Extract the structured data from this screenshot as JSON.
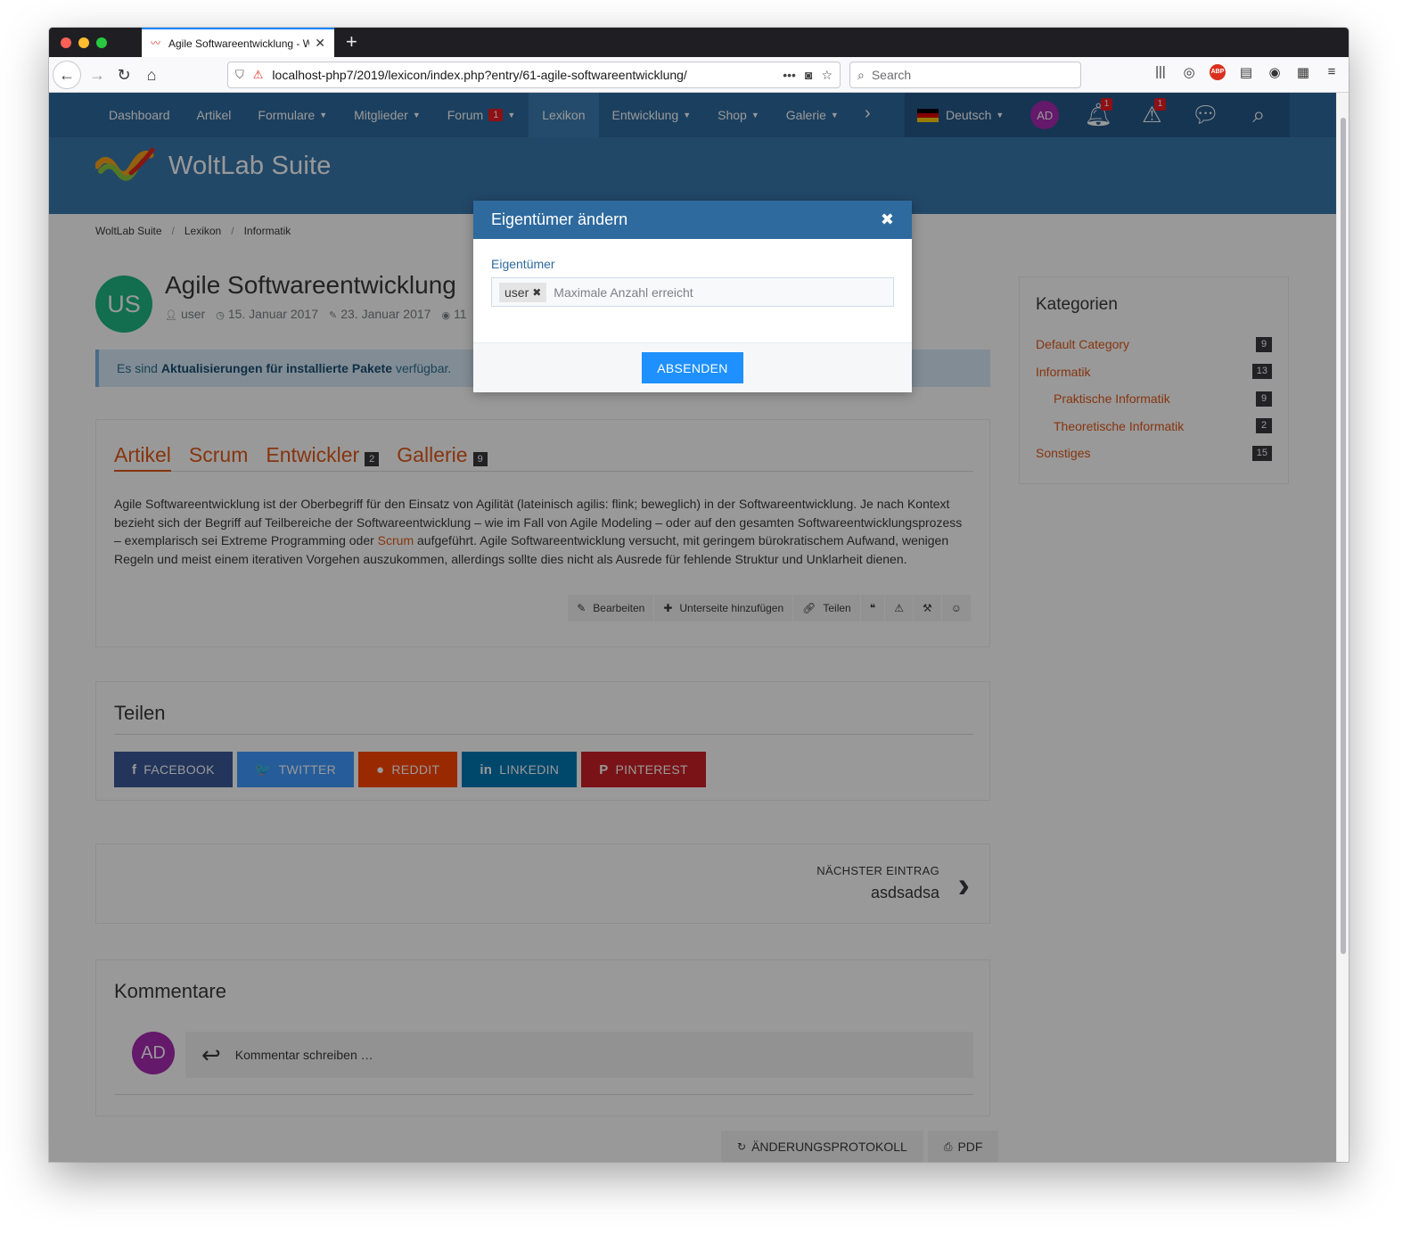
{
  "browser": {
    "tab_title": "Agile Softwareentwicklung - W",
    "url": "localhost-php7/2019/lexicon/index.php?entry/61-agile-softwareentwicklung/",
    "search_placeholder": "Search"
  },
  "site_nav": {
    "items": [
      {
        "label": "Dashboard"
      },
      {
        "label": "Artikel"
      },
      {
        "label": "Formulare",
        "dropdown": true
      },
      {
        "label": "Mitglieder",
        "dropdown": true
      },
      {
        "label": "Forum",
        "badge": "1",
        "dropdown": true
      },
      {
        "label": "Lexikon",
        "active": true
      },
      {
        "label": "Entwicklung",
        "dropdown": true
      },
      {
        "label": "Shop",
        "dropdown": true
      },
      {
        "label": "Galerie",
        "dropdown": true
      }
    ],
    "language": "Deutsch",
    "avatar_initials": "AD",
    "notifications_count": "1",
    "moderation_count": "1"
  },
  "header": {
    "logo_text": "WoltLab Suite"
  },
  "breadcrumb": [
    "WoltLab Suite",
    "Lexikon",
    "Informatik"
  ],
  "entry": {
    "avatar_initials": "US",
    "title": "Agile Softwareentwicklung",
    "author": "user",
    "created": "15. Januar 2017",
    "edited": "23. Januar 2017",
    "views": "11"
  },
  "notice": {
    "prefix": "Es sind",
    "bold": "Aktualisierungen für installierte Pakete",
    "suffix": "verfügbar."
  },
  "tabs": [
    {
      "label": "Artikel",
      "active": true
    },
    {
      "label": "Scrum"
    },
    {
      "label": "Entwickler",
      "badge": "2"
    },
    {
      "label": "Gallerie",
      "badge": "9"
    }
  ],
  "article": {
    "text_1": "Agile Softwareentwicklung ist der Oberbegriff für den Einsatz von Agilität (lateinisch agilis: flink; beweglich) in der Softwareentwicklung. Je nach Kontext bezieht sich der Begriff auf Teilbereiche der Softwareentwicklung – wie im Fall von Agile Modeling – oder auf den gesamten Softwareentwicklungsprozess – exemplarisch sei Extreme Programming oder",
    "link": "Scrum",
    "text_2": "aufgeführt. Agile Softwareentwicklung versucht, mit geringem bürokratischem Aufwand, wenigen Regeln und meist einem iterativen Vorgehen auszukommen, allerdings sollte dies nicht als Ausrede für fehlende Struktur und Unklarheit dienen."
  },
  "actions": {
    "edit": "Bearbeiten",
    "add_subpage": "Unterseite hinzufügen",
    "share": "Teilen"
  },
  "share": {
    "title": "Teilen",
    "buttons": [
      {
        "label": "FACEBOOK",
        "icon": "f",
        "color": "#3b5998"
      },
      {
        "label": "TWITTER",
        "icon": "🐦",
        "color": "#4099ff"
      },
      {
        "label": "REDDIT",
        "icon": "●",
        "color": "#ff4500"
      },
      {
        "label": "LINKEDIN",
        "icon": "in",
        "color": "#0077b5"
      },
      {
        "label": "PINTEREST",
        "icon": "P",
        "color": "#cb2027"
      }
    ]
  },
  "next_entry": {
    "label": "NÄCHSTER EINTRAG",
    "title": "asdsadsa"
  },
  "comments": {
    "title": "Kommentare",
    "avatar_initials": "AD",
    "placeholder": "Kommentar schreiben …"
  },
  "footer_buttons": {
    "changelog": "ÄNDERUNGSPROTOKOLL",
    "pdf": "PDF"
  },
  "sidebar": {
    "title": "Kategorien",
    "items": [
      {
        "label": "Default Category",
        "count": "9"
      },
      {
        "label": "Informatik",
        "count": "13"
      },
      {
        "label": "Praktische Informatik",
        "count": "9",
        "sub": true
      },
      {
        "label": "Theoretische Informatik",
        "count": "2",
        "sub": true
      },
      {
        "label": "Sonstiges",
        "count": "15"
      }
    ]
  },
  "dialog": {
    "title": "Eigentümer ändern",
    "field_label": "Eigentümer",
    "chip": "user",
    "field_placeholder": "Maximale Anzahl erreicht",
    "submit": "ABSENDEN"
  }
}
